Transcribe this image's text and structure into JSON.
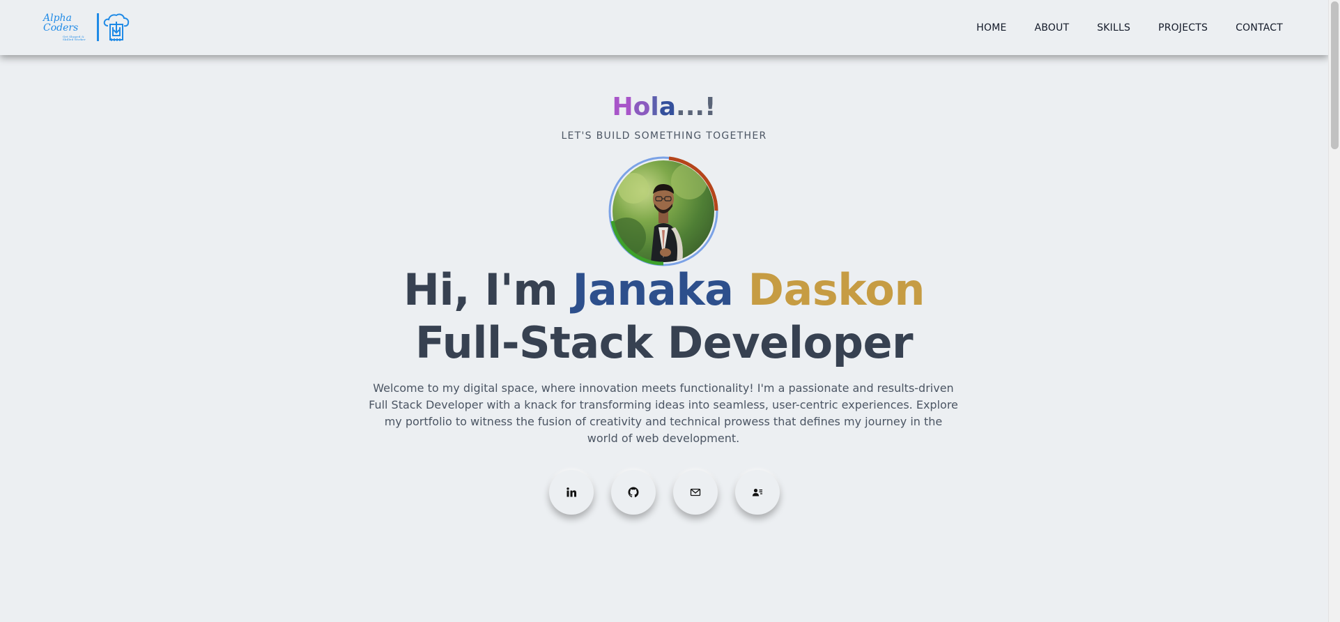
{
  "logo": {
    "name": "Alpha Coders",
    "sub": "Get Shaped & Skilled Worker"
  },
  "nav": [
    {
      "label": "HOME"
    },
    {
      "label": "ABOUT"
    },
    {
      "label": "SKILLS"
    },
    {
      "label": "PROJECTS"
    },
    {
      "label": "CONTACT"
    }
  ],
  "hero": {
    "greeting": {
      "parts": [
        "H",
        "o",
        "l",
        "a",
        "...!"
      ]
    },
    "tagline": "LET'S BUILD SOMETHING TOGETHER",
    "headline_prefix": "Hi, I'm",
    "first_name": "Janaka",
    "last_name": "Daskon",
    "role": "Full-Stack Developer",
    "intro": "Welcome to my digital space, where innovation meets functionality! I'm a passionate and results-driven Full Stack Developer with a knack for transforming ideas into seamless, user-centric experiences. Explore my portfolio to witness the fusion of creativity and technical prowess that defines my journey in the world of web development."
  },
  "socials": [
    {
      "icon": "linkedin-icon"
    },
    {
      "icon": "github-icon"
    },
    {
      "icon": "mail-icon"
    },
    {
      "icon": "contact-card-icon"
    }
  ],
  "colors": {
    "background": "#eceff2",
    "first_name": "#2d4f8c",
    "last_name": "#c69c43",
    "logo": "#1f8ae6"
  }
}
